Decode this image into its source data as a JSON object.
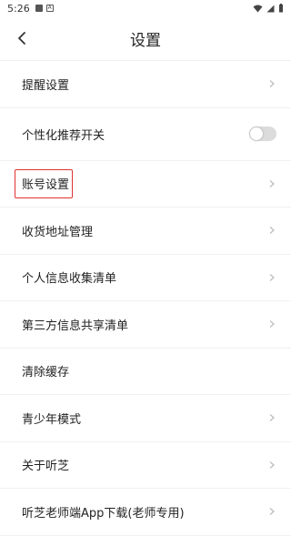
{
  "status_bar": {
    "time": "5:26"
  },
  "header": {
    "title": "设置"
  },
  "settings": {
    "items": [
      {
        "label": "提醒设置"
      },
      {
        "label": "个性化推荐开关",
        "toggle": false
      },
      {
        "label": "账号设置"
      },
      {
        "label": "收货地址管理"
      },
      {
        "label": "个人信息收集清单"
      },
      {
        "label": "第三方信息共享清单"
      },
      {
        "label": "清除缓存"
      },
      {
        "label": "青少年模式"
      },
      {
        "label": "关于听芝"
      },
      {
        "label": "听芝老师端App下载(老师专用)"
      }
    ]
  },
  "colors": {
    "highlight": "#e03232",
    "toggle_off": "#dcdcdc"
  },
  "icons": [
    "back-arrow-icon",
    "chevron-right-icon",
    "wifi-icon",
    "signal-icon",
    "battery-icon"
  ]
}
